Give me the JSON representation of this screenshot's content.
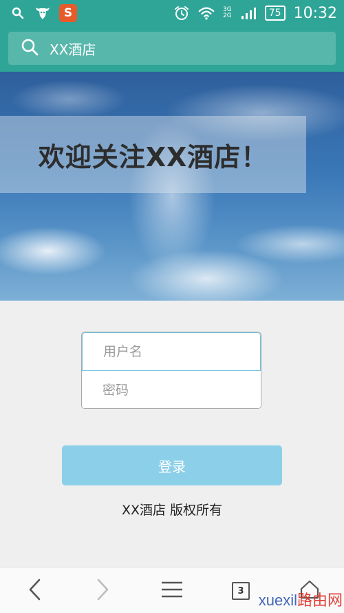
{
  "status_bar": {
    "net_top": "3G",
    "net_bottom": "2G",
    "battery": "75",
    "time": "10:32",
    "app_badge": "S"
  },
  "search": {
    "text": "XX酒店"
  },
  "hero": {
    "title": "欢迎关注XX酒店！"
  },
  "form": {
    "username_placeholder": "用户名",
    "password_placeholder": "密码",
    "login_label": "登录"
  },
  "footer": {
    "copyright": "XX酒店  版权所有"
  },
  "bottom_nav": {
    "tab_count": "3"
  },
  "watermark": {
    "prefix": "xuexil",
    "suffix": "路由网"
  },
  "colors": {
    "header": "#2fa597",
    "login_button": "#8ccfe8",
    "field_focus": "#6fc3e0"
  }
}
